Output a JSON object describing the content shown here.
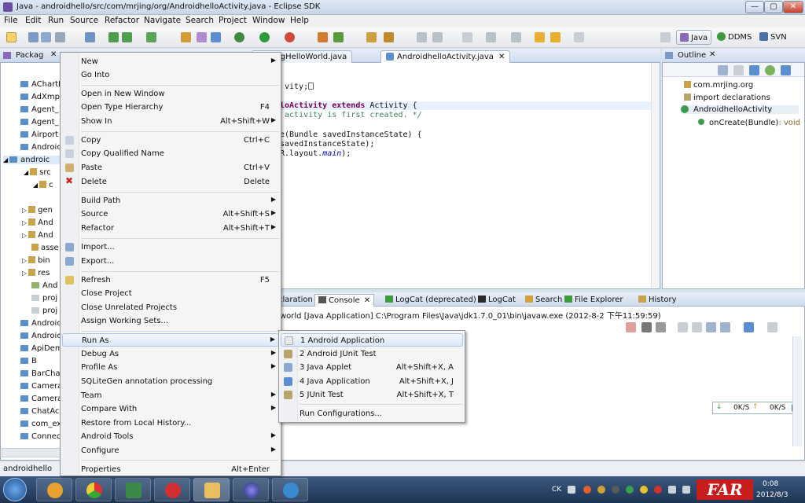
{
  "window": {
    "title": "Java - androidhello/src/com/mrjing/org/AndroidhelloActivity.java - Eclipse SDK",
    "controls": {
      "minimize": "—",
      "maximize": "▢",
      "close": "✕"
    }
  },
  "menubar": [
    "File",
    "Edit",
    "Run",
    "Source",
    "Refactor",
    "Navigate",
    "Search",
    "Project",
    "Window",
    "Help"
  ],
  "perspectives": [
    "Java",
    "DDMS",
    "SVN"
  ],
  "package_explorer": {
    "tab": "Packag",
    "items": [
      "AChartE",
      "AdXmp",
      "Agent_1",
      "Agent_1",
      "Airport",
      "Androic",
      "androic",
      "src",
      "c",
      "gen",
      "And",
      "And",
      "asse",
      "bin",
      "res",
      "And",
      "proj",
      "proj",
      "Androic",
      "Androic",
      "ApiDem",
      "B",
      "BarCha",
      "Camera",
      "Camera",
      "ChatAct",
      "com_ex",
      "Connec"
    ]
  },
  "editor": {
    "tabs": [
      "eSwingHelloWorld.java",
      "AndroidhelloActivity.java"
    ],
    "code": {
      "l1": "vity;",
      "l2_kw": "loActivity extends",
      "l2_rest": " Activity {",
      "l3": " activity is first created. */",
      "l4": "e(Bundle savedInstanceState) {",
      "l5": "savedInstanceState);",
      "l6a": "R.layout.",
      "l6b": "main",
      "l6c": ");"
    }
  },
  "outline": {
    "tab": "Outline",
    "items": [
      "com.mrjing.org",
      "import declarations",
      "AndroidhelloActivity",
      "onCreate(Bundle)",
      ": void"
    ]
  },
  "console": {
    "tabs": [
      "claration",
      "Console",
      "LogCat (deprecated)",
      "LogCat",
      "Search",
      "File Explorer",
      "History"
    ],
    "text": "world [Java Application] C:\\Program Files\\Java\\jdk1.7.0_01\\bin\\javaw.exe (2012-8-2 下午11:59:59)"
  },
  "network": {
    "down": "0K/S",
    "up": "0K/S"
  },
  "statusbar": {
    "text": "androidhello"
  },
  "context_menu": {
    "items": [
      {
        "label": "New",
        "shortcut": "",
        "submenu": true
      },
      {
        "label": "Go Into",
        "shortcut": "",
        "submenu": false
      },
      {
        "label": "Open in New Window",
        "shortcut": "",
        "submenu": false
      },
      {
        "label": "Open Type Hierarchy",
        "shortcut": "F4",
        "submenu": false
      },
      {
        "label": "Show In",
        "shortcut": "Alt+Shift+W",
        "submenu": true
      },
      {
        "label": "Copy",
        "shortcut": "Ctrl+C",
        "submenu": false
      },
      {
        "label": "Copy Qualified Name",
        "shortcut": "",
        "submenu": false
      },
      {
        "label": "Paste",
        "shortcut": "Ctrl+V",
        "submenu": false
      },
      {
        "label": "Delete",
        "shortcut": "Delete",
        "submenu": false
      },
      {
        "label": "Build Path",
        "shortcut": "",
        "submenu": true
      },
      {
        "label": "Source",
        "shortcut": "Alt+Shift+S",
        "submenu": true
      },
      {
        "label": "Refactor",
        "shortcut": "Alt+Shift+T",
        "submenu": true
      },
      {
        "label": "Import...",
        "shortcut": "",
        "submenu": false
      },
      {
        "label": "Export...",
        "shortcut": "",
        "submenu": false
      },
      {
        "label": "Refresh",
        "shortcut": "F5",
        "submenu": false
      },
      {
        "label": "Close Project",
        "shortcut": "",
        "submenu": false
      },
      {
        "label": "Close Unrelated Projects",
        "shortcut": "",
        "submenu": false
      },
      {
        "label": "Assign Working Sets...",
        "shortcut": "",
        "submenu": false
      },
      {
        "label": "Run As",
        "shortcut": "",
        "submenu": true
      },
      {
        "label": "Debug As",
        "shortcut": "",
        "submenu": true
      },
      {
        "label": "Profile As",
        "shortcut": "",
        "submenu": true
      },
      {
        "label": "SQLiteGen annotation processing",
        "shortcut": "",
        "submenu": false
      },
      {
        "label": "Team",
        "shortcut": "",
        "submenu": true
      },
      {
        "label": "Compare With",
        "shortcut": "",
        "submenu": true
      },
      {
        "label": "Restore from Local History...",
        "shortcut": "",
        "submenu": false
      },
      {
        "label": "Android Tools",
        "shortcut": "",
        "submenu": true
      },
      {
        "label": "Configure",
        "shortcut": "",
        "submenu": true
      },
      {
        "label": "Properties",
        "shortcut": "Alt+Enter",
        "submenu": false
      }
    ]
  },
  "run_as_submenu": {
    "items": [
      {
        "label": "1 Android Application",
        "shortcut": ""
      },
      {
        "label": "2 Android JUnit Test",
        "shortcut": ""
      },
      {
        "label": "3 Java Applet",
        "shortcut": "Alt+Shift+X, A"
      },
      {
        "label": "4 Java Application",
        "shortcut": "Alt+Shift+X, J"
      },
      {
        "label": "5 JUnit Test",
        "shortcut": "Alt+Shift+X, T"
      },
      {
        "label": "Run Configurations...",
        "shortcut": ""
      }
    ]
  },
  "taskbar": {
    "tray": {
      "lang": "CK",
      "time": "0:08",
      "date": "2012/8/3"
    },
    "watermark": "FAR"
  },
  "colors": {
    "accent": "#3a6ea5",
    "highlight": "#dce9f8",
    "keyword": "#7f0055",
    "comment": "#3f7f5f"
  }
}
